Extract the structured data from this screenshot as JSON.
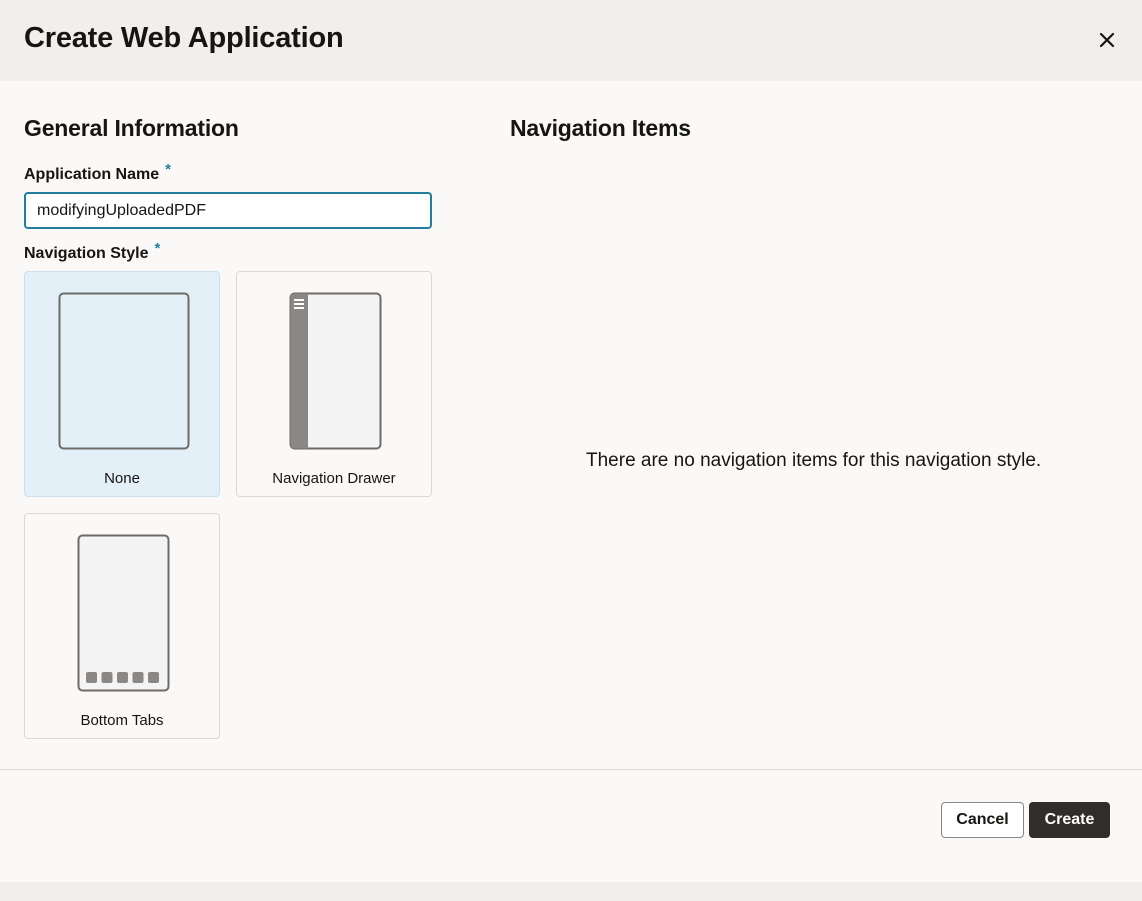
{
  "dialog": {
    "title": "Create Web Application",
    "close_icon": "close-icon"
  },
  "general": {
    "heading": "General Information",
    "app_name_label": "Application Name",
    "app_name_required": "*",
    "app_name_value": "modifyingUploadedPDF",
    "nav_style_label": "Navigation Style",
    "nav_style_required": "*",
    "nav_styles": [
      {
        "label": "None",
        "icon": "blank-phone-icon",
        "selected": true
      },
      {
        "label": "Navigation Drawer",
        "icon": "navigation-drawer-phone-icon",
        "selected": false
      },
      {
        "label": "Bottom Tabs",
        "icon": "bottom-tabs-phone-icon",
        "selected": false
      }
    ]
  },
  "navigation_items": {
    "heading": "Navigation Items",
    "empty_message": "There are no navigation items for this navigation style."
  },
  "footer": {
    "cancel_label": "Cancel",
    "create_label": "Create"
  },
  "colors": {
    "accent": "#227e9e",
    "selected_card_bg": "#e4f0f7",
    "primary_button_bg": "#312d2a"
  }
}
